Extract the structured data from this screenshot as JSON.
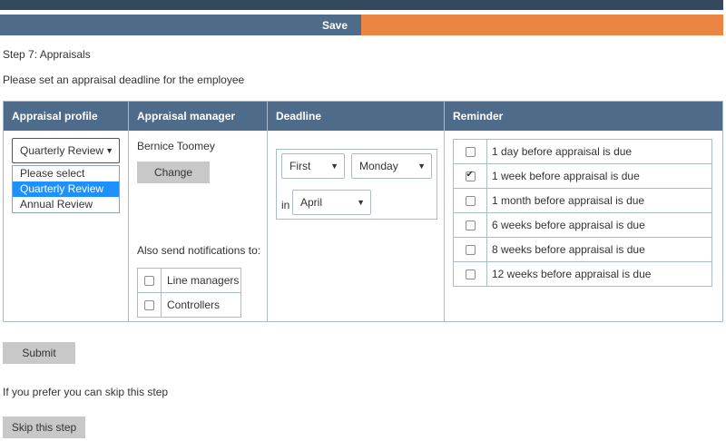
{
  "toolbar": {
    "save_label": "Save"
  },
  "step_title": "Step 7: Appraisals",
  "intro_text": "Please set an appraisal deadline for the employee",
  "columns": {
    "profile": "Appraisal profile",
    "manager": "Appraisal manager",
    "deadline": "Deadline",
    "reminder": "Reminder"
  },
  "profile": {
    "selected": "Quarterly Review",
    "options": [
      "Please select",
      "Quarterly Review",
      "Annual Review"
    ]
  },
  "manager": {
    "name": "Bernice Toomey",
    "change_label": "Change",
    "also_send": "Also send notifications to:",
    "notifications": [
      {
        "label": "Line managers",
        "checked": false
      },
      {
        "label": "Controllers",
        "checked": false
      }
    ]
  },
  "deadline": {
    "ordinal": "First",
    "weekday": "Monday",
    "in_label": "in",
    "month": "April"
  },
  "reminders": [
    {
      "label": "1 day before appraisal is due",
      "checked": false
    },
    {
      "label": "1 week before appraisal is due",
      "checked": true
    },
    {
      "label": "1 month before appraisal is due",
      "checked": false
    },
    {
      "label": "6 weeks before appraisal is due",
      "checked": false
    },
    {
      "label": "8 weeks before appraisal is due",
      "checked": false
    },
    {
      "label": "12 weeks before appraisal is due",
      "checked": false
    }
  ],
  "submit_label": "Submit",
  "skip_text": "If you prefer you can skip this step",
  "skip_label": "Skip this step",
  "colors": {
    "header": "#4e6b8a",
    "accent": "#eb8544",
    "topbar": "#34495e"
  }
}
